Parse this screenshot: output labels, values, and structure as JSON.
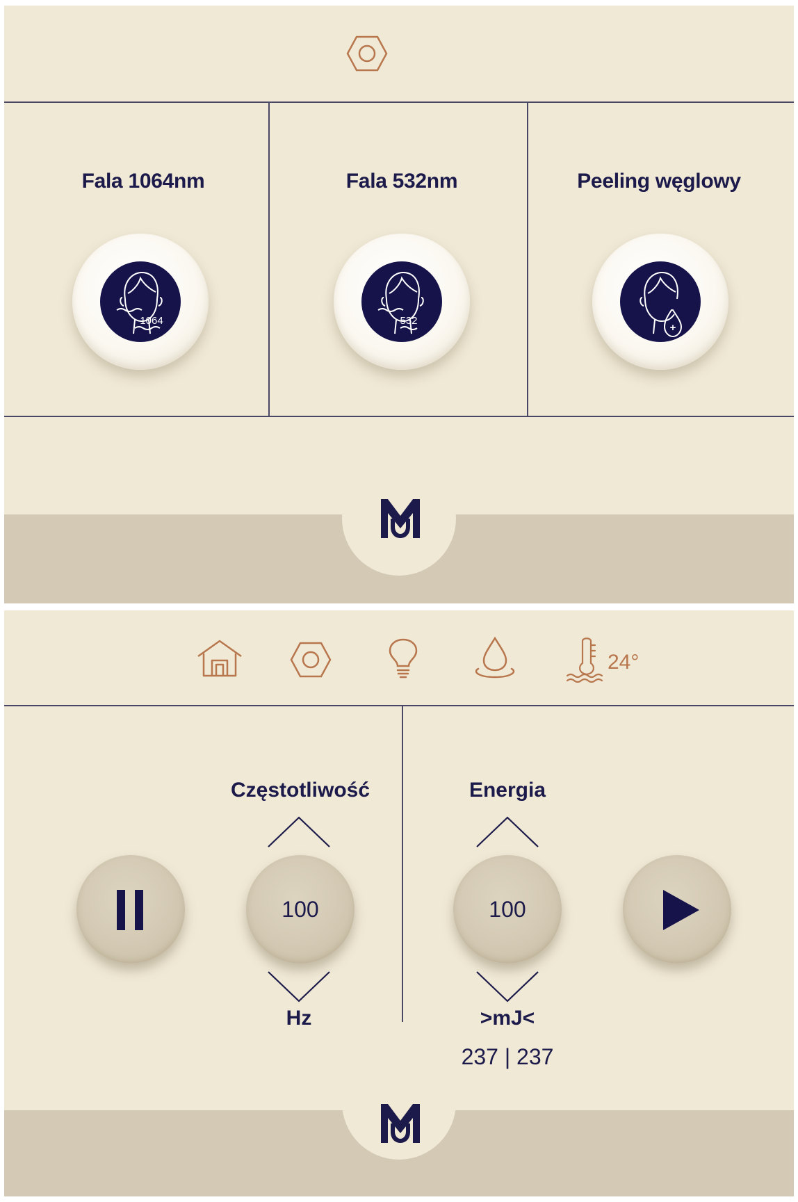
{
  "colors": {
    "background": "#f0e9d6",
    "footer_band": "#d3c9b4",
    "divider": "#4a4766",
    "navy": "#16134a",
    "icon_accent": "#b8764d"
  },
  "screen1": {
    "top_icon": "hexagon-nut-icon",
    "modes": [
      {
        "title": "Fala 1064nm",
        "icon": "face-wave-1064-icon",
        "badge": "1064"
      },
      {
        "title": "Fala 532nm",
        "icon": "face-wave-532-icon",
        "badge": "532"
      },
      {
        "title": "Peeling węglowy",
        "icon": "face-drop-plus-icon",
        "badge": "+"
      }
    ],
    "logo": "MU-logo"
  },
  "screen2": {
    "status_icons": [
      "home-icon",
      "hexagon-nut-icon",
      "lightbulb-icon",
      "water-drop-icon",
      "thermometer-icon"
    ],
    "temperature": "24°",
    "frequency": {
      "label": "Częstotliwość",
      "value": "100",
      "unit": "Hz"
    },
    "energy": {
      "label": "Energia",
      "value": "100",
      "unit": ">mJ<"
    },
    "counter": "237 | 237",
    "pause_icon": "pause-icon",
    "play_icon": "play-icon",
    "logo": "MU-logo"
  }
}
